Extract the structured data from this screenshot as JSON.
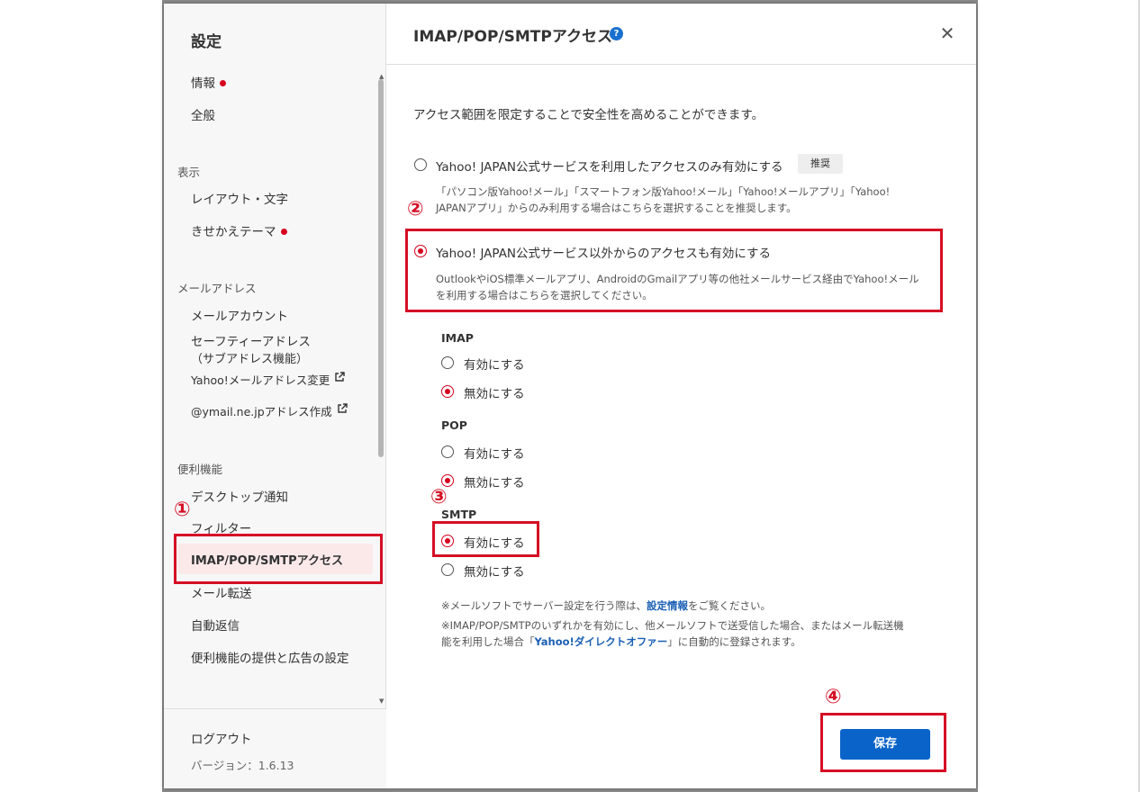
{
  "sidebar": {
    "title": "設定",
    "items": [
      {
        "label": "情報"
      },
      {
        "label": "全般"
      }
    ],
    "sections": {
      "display": {
        "title": "表示",
        "items": [
          "レイアウト・文字",
          "きせかえテーマ"
        ]
      },
      "mail_address": {
        "title": "メールアドレス",
        "items": [
          "メールアカウント",
          "セーフティーアドレス",
          "（サブアドレス機能）",
          "Yahoo!メールアドレス変更",
          "@ymail.ne.jpアドレス作成"
        ]
      },
      "features": {
        "title": "便利機能",
        "items": [
          "デスクトップ通知",
          "フィルター",
          "IMAP/POP/SMTPアクセス",
          "メール転送",
          "自動返信",
          "便利機能の提供と広告の設定"
        ]
      }
    },
    "footer": {
      "logout": "ログアウト",
      "version": "バージョン：1.6.13"
    }
  },
  "header": {
    "title": "IMAP/POP/SMTPアクセス",
    "help": "?",
    "close": "✕"
  },
  "main": {
    "intro": "アクセス範囲を限定することで安全性を高めることができます。",
    "option1": {
      "label": "Yahoo! JAPAN公式サービスを利用したアクセスのみ有効にする",
      "badge": "推奨",
      "desc_line1": "「パソコン版Yahoo!メール」「スマートフォン版Yahoo!メール」「Yahoo!メールアプリ」「Yahoo!",
      "desc_line2": "JAPANアプリ」からのみ利用する場合はこちらを選択することを推奨します。"
    },
    "option2": {
      "label": "Yahoo! JAPAN公式サービス以外からのアクセスも有効にする",
      "desc_line1": "OutlookやiOS標準メールアプリ、AndroidのGmailアプリ等の他社メールサービス経由でYahoo!メール",
      "desc_line2": "を利用する場合はこちらを選択してください。"
    },
    "imap": {
      "title": "IMAP",
      "enable": "有効にする",
      "disable": "無効にする",
      "selected": "disable"
    },
    "pop": {
      "title": "POP",
      "enable": "有効にする",
      "disable": "無効にする",
      "selected": "disable"
    },
    "smtp": {
      "title": "SMTP",
      "enable": "有効にする",
      "disable": "無効にする",
      "selected": "enable"
    },
    "note1_prefix": "※メールソフトでサーバー設定を行う際は、",
    "note1_link": "設定情報",
    "note1_suffix": "をご覧ください。",
    "note2_line1": "※IMAP/POP/SMTPのいずれかを有効にし、他メールソフトで送受信した場合、またはメール転送機",
    "note2_prefix": "能を利用した場合「",
    "note2_link": "Yahoo!ダイレクトオファー",
    "note2_suffix": "」に自動的に登録されます。",
    "save_label": "保存"
  },
  "annotations": [
    "①",
    "②",
    "③",
    "④"
  ],
  "colors": {
    "accent_red": "#d7001e",
    "annotation_red": "#d50f25",
    "primary_blue": "#0a63c9",
    "link_blue": "#1a5fb4",
    "selected_bg": "#fbe9ea"
  }
}
